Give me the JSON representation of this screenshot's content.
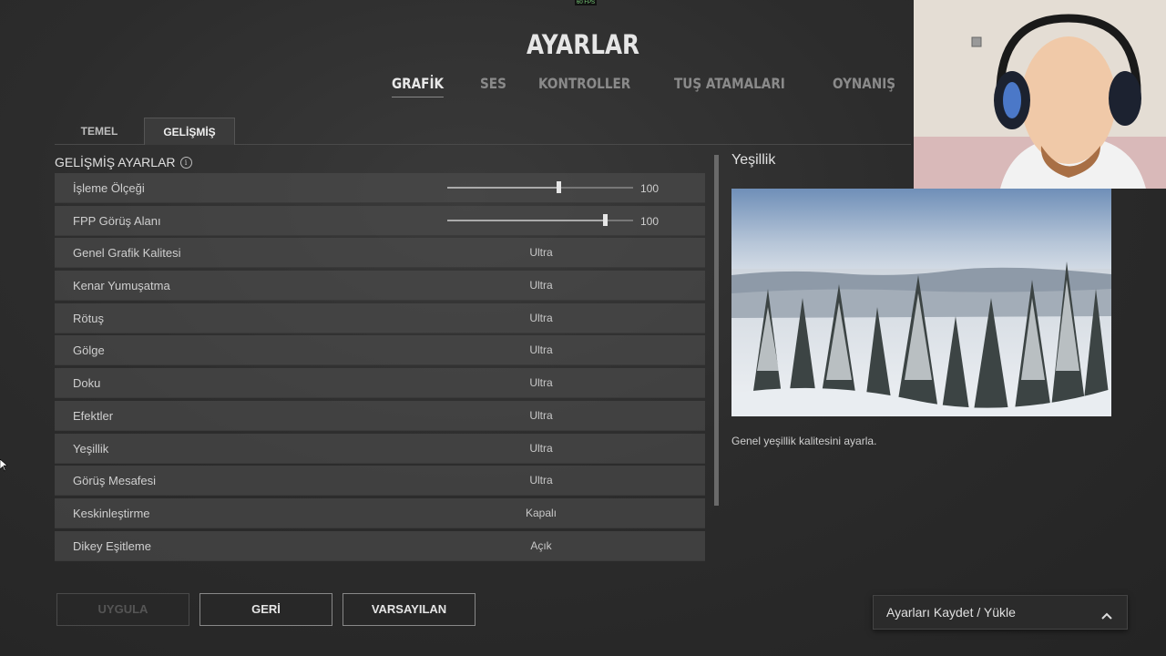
{
  "hud": {
    "fps": "60 FPS"
  },
  "title": "AYARLAR",
  "main_tabs": [
    "GRAFİK",
    "SES",
    "KONTROLLER",
    "TUŞ ATAMALARI",
    "OYNANIŞ"
  ],
  "sub_tabs": [
    "TEMEL",
    "GELİŞMİŞ"
  ],
  "section_title": "GELİŞMİŞ AYARLAR",
  "sliders": [
    {
      "label": "İşleme Ölçeği",
      "value": "100",
      "level": 0.6
    },
    {
      "label": "FPP Görüş Alanı",
      "value": "100",
      "level": 0.85
    }
  ],
  "options": [
    {
      "label": "Genel Grafik Kalitesi",
      "value": "Ultra"
    },
    {
      "label": "Kenar Yumuşatma",
      "value": "Ultra"
    },
    {
      "label": "Rötuş",
      "value": "Ultra"
    },
    {
      "label": "Gölge",
      "value": "Ultra"
    },
    {
      "label": "Doku",
      "value": "Ultra"
    },
    {
      "label": "Efektler",
      "value": "Ultra"
    },
    {
      "label": "Yeşillik",
      "value": "Ultra"
    },
    {
      "label": "Görüş Mesafesi",
      "value": "Ultra"
    },
    {
      "label": "Keskinleştirme",
      "value": "Kapalı"
    },
    {
      "label": "Dikey Eşitleme",
      "value": "Açık"
    }
  ],
  "preview": {
    "title": "Yeşillik",
    "description": "Genel yeşillik kalitesini ayarla."
  },
  "buttons": {
    "apply": "UYGULA",
    "back": "GERİ",
    "defaults": "VARSAYILAN"
  },
  "save_load": "Ayarları Kaydet / Yükle"
}
